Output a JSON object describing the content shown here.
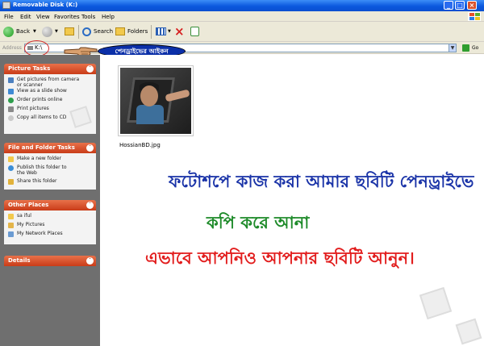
{
  "window": {
    "title": "Removable Disk (K:)"
  },
  "menu": [
    "File",
    "Edit",
    "View",
    "Favorites",
    "Tools",
    "Help"
  ],
  "toolbar": {
    "back": "Back",
    "search": "Search",
    "folders": "Folders"
  },
  "address": {
    "label": "Address",
    "value": "K:\\",
    "go": "Go"
  },
  "annotation": {
    "label": "পেনড্রাইভের আইকন"
  },
  "picture_tasks": {
    "title": "Picture Tasks",
    "items": [
      "Get pictures from camera or scanner",
      "View as a slide show",
      "Order prints online",
      "Print pictures",
      "Copy all items to CD"
    ]
  },
  "file_tasks": {
    "title": "File and Folder Tasks",
    "items": [
      "Make a new folder",
      "Publish this folder to the Web",
      "Share this folder"
    ]
  },
  "other_places": {
    "title": "Other Places",
    "items": [
      "sa iful",
      "My Pictures",
      "My Network Places"
    ]
  },
  "details": {
    "title": "Details"
  },
  "file": {
    "name": "HossianBD.jpg"
  },
  "overlay": {
    "line1": "ফটোশপে কাজ করা আমার ছবিটি পেনড্রাইভে",
    "line2": "কপি করে আনা",
    "line3": "এভাবে আপনিও আপনার ছবিটি আনুন।"
  },
  "colors": {
    "line1": "#1b34a8",
    "line2": "#1e8b2a",
    "line3": "#e21d1d",
    "panel_head": "#d4502a",
    "xp_title": "#0a58de"
  }
}
